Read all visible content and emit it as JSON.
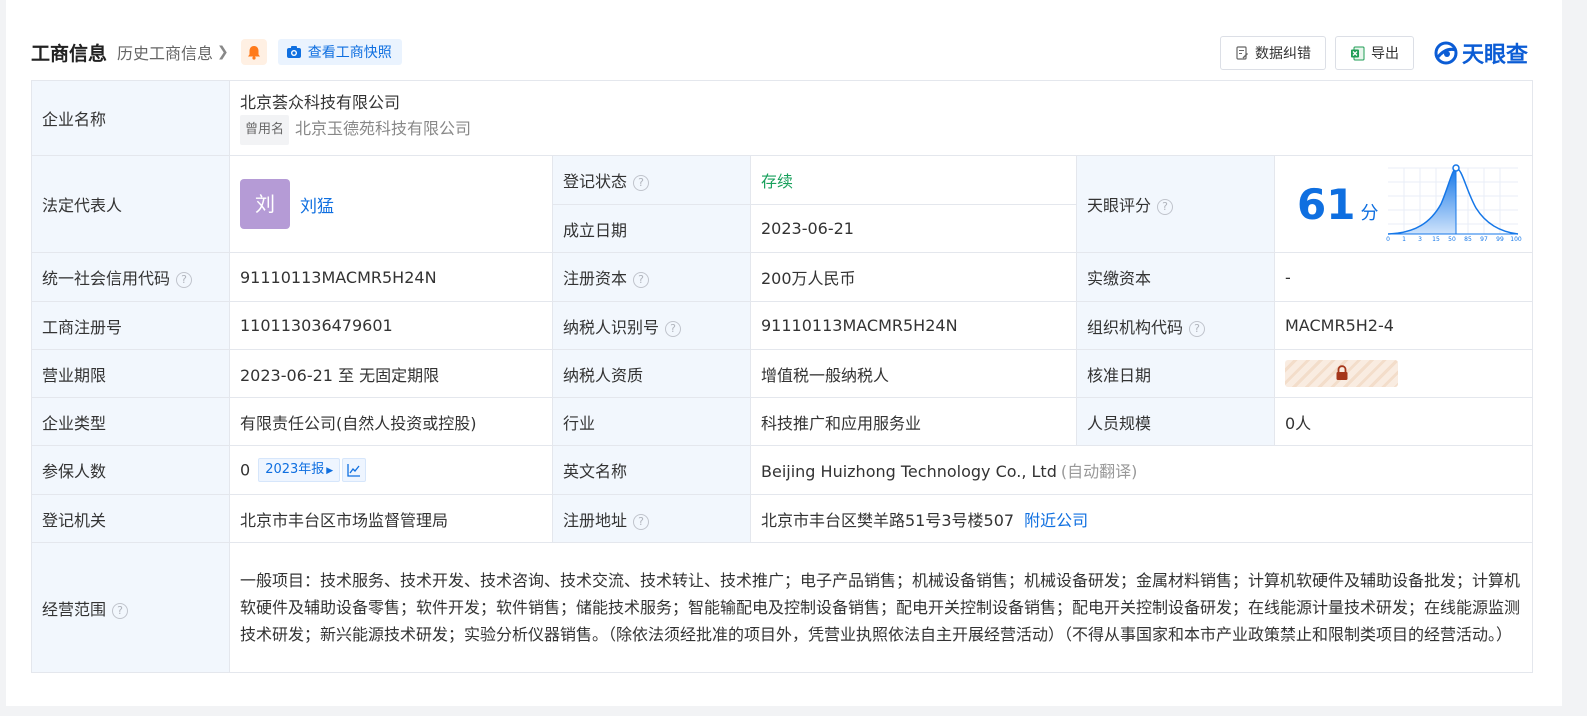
{
  "header": {
    "title": "工商信息",
    "history_label": "历史工商信息",
    "snapshot_label": "查看工商快照",
    "error_label": "数据纠错",
    "export_label": "导出",
    "logo_text": "天眼查"
  },
  "table": {
    "company_name_label": "企业名称",
    "company_name": "北京荟众科技有限公司",
    "former_name_tag": "曾用名",
    "former_name": "北京玉德苑科技有限公司",
    "legal_rep_label": "法定代表人",
    "legal_rep_avatar": "刘",
    "legal_rep": "刘猛",
    "reg_status_label": "登记状态",
    "reg_status": "存续",
    "found_date_label": "成立日期",
    "found_date": "2023-06-21",
    "score_label": "天眼评分",
    "score": "61",
    "score_unit": "分",
    "score_axis": [
      "0",
      "1",
      "3",
      "15",
      "50",
      "85",
      "97",
      "99",
      "100"
    ],
    "credit_code_label": "统一社会信用代码",
    "credit_code": "91110113MACMR5H24N",
    "reg_capital_label": "注册资本",
    "reg_capital": "200万人民币",
    "paid_capital_label": "实缴资本",
    "paid_capital": "-",
    "reg_no_label": "工商注册号",
    "reg_no": "110113036479601",
    "taxpayer_id_label": "纳税人识别号",
    "taxpayer_id": "91110113MACMR5H24N",
    "org_code_label": "组织机构代码",
    "org_code": "MACMR5H2-4",
    "term_label": "营业期限",
    "term": "2023-06-21 至 无固定期限",
    "taxpayer_qual_label": "纳税人资质",
    "taxpayer_qual": "增值税一般纳税人",
    "approve_date_label": "核准日期",
    "company_type_label": "企业类型",
    "company_type": "有限责任公司(自然人投资或控股)",
    "industry_label": "行业",
    "industry": "科技推广和应用服务业",
    "staff_size_label": "人员规模",
    "staff_size": "0人",
    "insured_label": "参保人数",
    "insured": "0",
    "insured_report": "2023年报",
    "english_name_label": "英文名称",
    "english_name": "Beijing Huizhong Technology Co., Ltd",
    "english_name_note": "(自动翻译)",
    "authority_label": "登记机关",
    "authority": "北京市丰台区市场监督管理局",
    "address_label": "注册地址",
    "address": "北京市丰台区樊羊路51号3号楼507",
    "nearby_link": "附近公司",
    "scope_label": "经营范围",
    "scope": "一般项目：技术服务、技术开发、技术咨询、技术交流、技术转让、技术推广；电子产品销售；机械设备销售；机械设备研发；金属材料销售；计算机软硬件及辅助设备批发；计算机软硬件及辅助设备零售；软件开发；软件销售；储能技术服务；智能输配电及控制设备销售；配电开关控制设备销售；配电开关控制设备研发；在线能源计量技术研发；在线能源监测技术研发；新兴能源技术研发；实验分析仪器销售。（除依法须经批准的项目外，凭营业执照依法自主开展经营活动）（不得从事国家和本市产业政策禁止和限制类项目的经营活动。）"
  },
  "colors": {
    "accent": "#0f6fe0",
    "label_bg": "#f2f7fd",
    "status_green": "#19a05c",
    "avatar_bg": "#b59bd6"
  }
}
